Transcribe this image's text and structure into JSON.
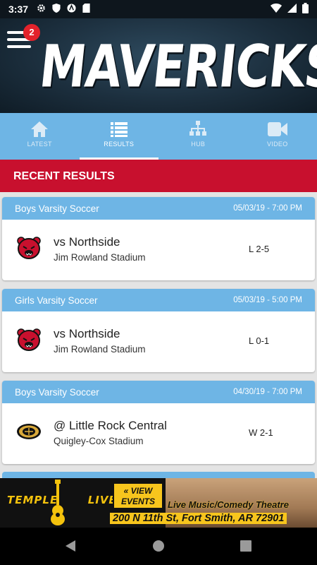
{
  "status_bar": {
    "time": "3:37"
  },
  "header": {
    "title": "MAVERICKS",
    "notification_count": "2"
  },
  "tabs": [
    {
      "label": "LATEST",
      "icon": "home-icon"
    },
    {
      "label": "RESULTS",
      "icon": "list-icon",
      "active": true
    },
    {
      "label": "HUB",
      "icon": "sitemap-icon"
    },
    {
      "label": "VIDEO",
      "icon": "video-icon"
    }
  ],
  "section_title": "RECENT RESULTS",
  "results": [
    {
      "team": "Boys Varsity Soccer",
      "datetime": "05/03/19 - 7:00 PM",
      "opponent": "vs Northside",
      "venue": "Jim Rowland Stadium",
      "score": "L 2-5",
      "logo": "bear-logo-icon"
    },
    {
      "team": "Girls Varsity Soccer",
      "datetime": "05/03/19 - 5:00 PM",
      "opponent": "vs Northside",
      "venue": "Jim Rowland Stadium",
      "score": "L 0-1",
      "logo": "bear-logo-icon"
    },
    {
      "team": "Boys Varsity Soccer",
      "datetime": "04/30/19 - 7:00 PM",
      "opponent": "@ Little Rock Central",
      "venue": "Quigley-Cox Stadium",
      "score": "W 2-1",
      "logo": "tiger-logo-icon"
    }
  ],
  "ad": {
    "brand_left": "TEMPLE",
    "brand_right": "LIVE",
    "cta_line1": "« VIEW",
    "cta_line2": "EVENTS",
    "tagline": "Live Music/Comedy Theatre",
    "address": "200 N 11th St, Fort Smith, AR 72901"
  },
  "colors": {
    "accent_blue": "#6eb5e5",
    "section_red": "#c8102e",
    "header_dark": "#1c2f3e"
  }
}
